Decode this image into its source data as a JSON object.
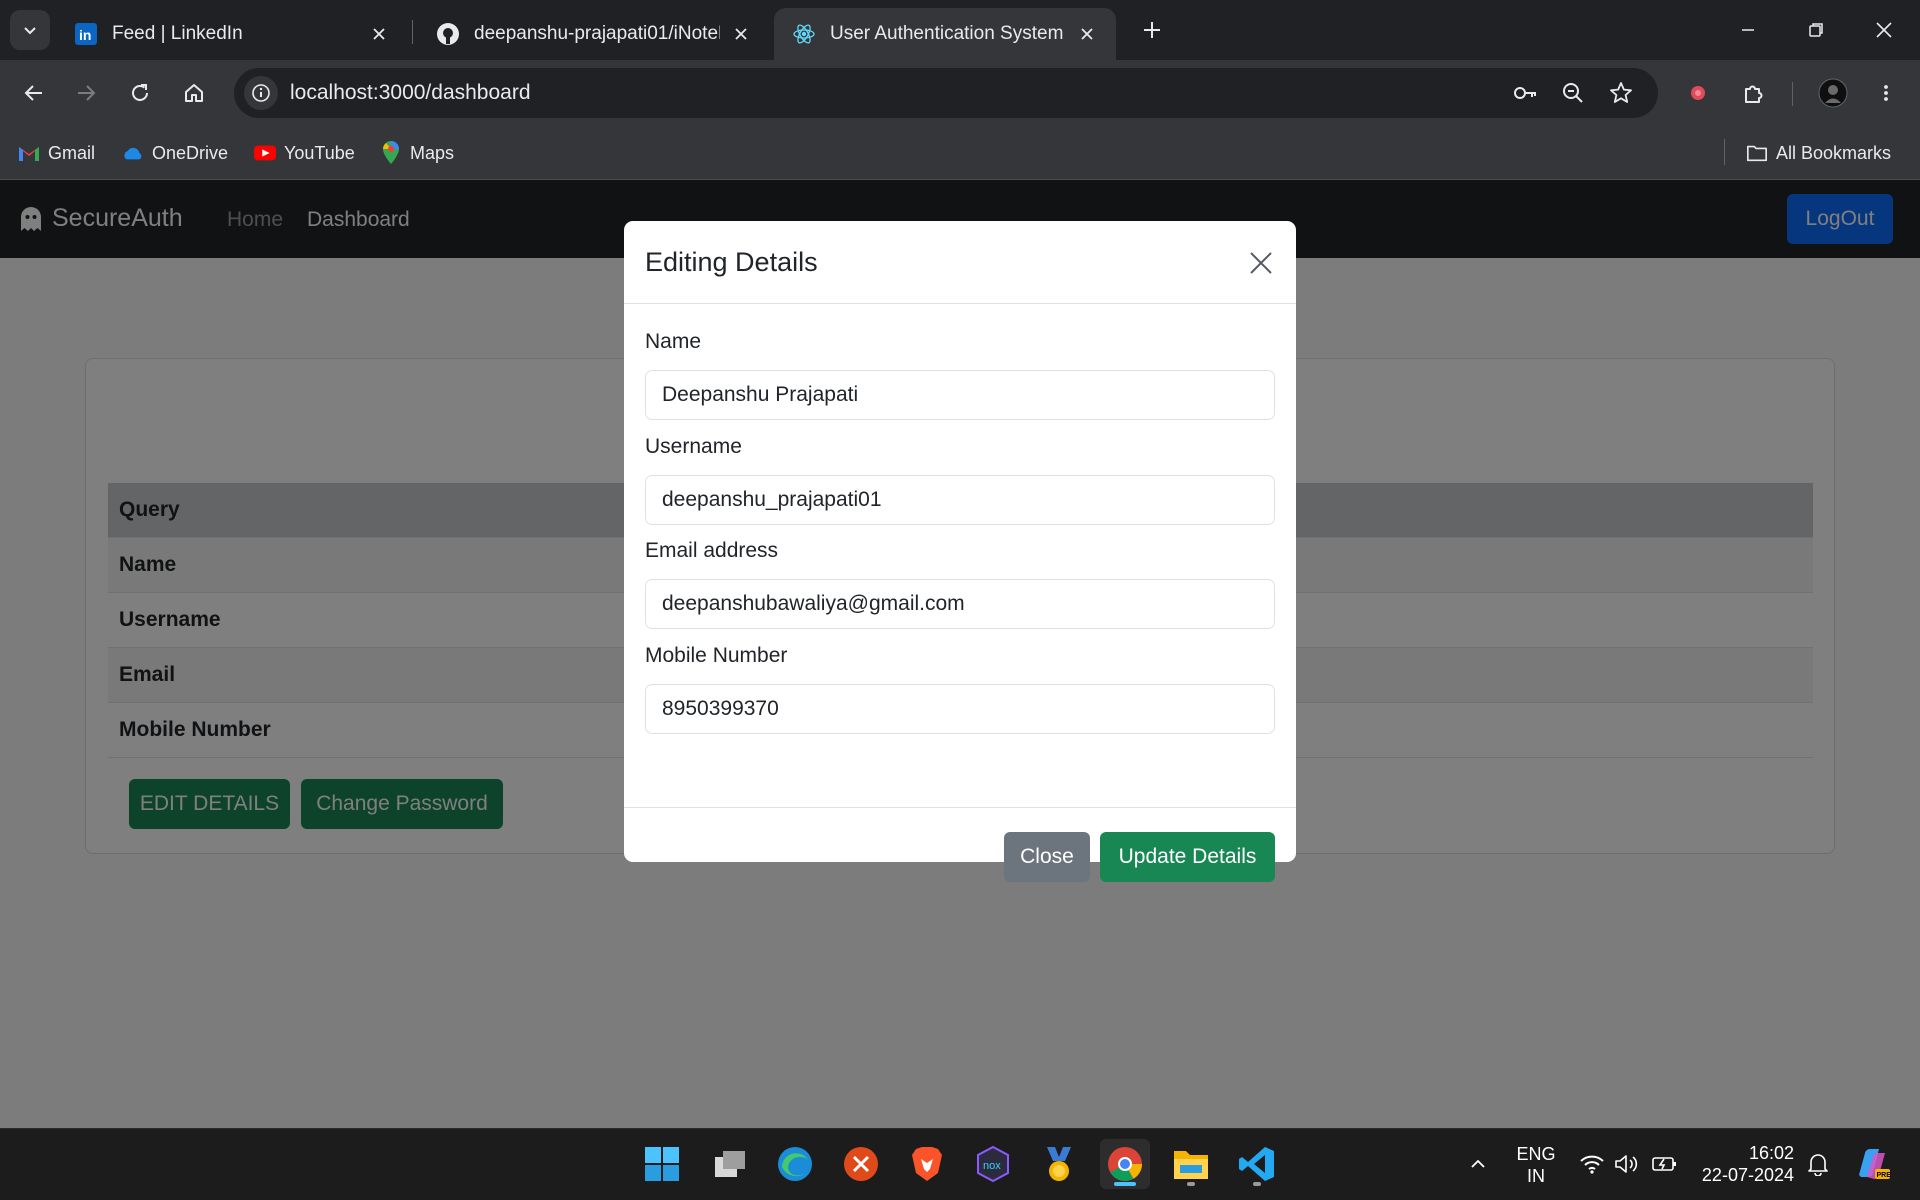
{
  "browser": {
    "tabs": [
      {
        "title": "Feed | LinkedIn",
        "icon": "linkedin-icon"
      },
      {
        "title": "deepanshu-prajapati01/iNoteBo",
        "icon": "github-icon"
      },
      {
        "title": "User Authentication System",
        "icon": "react-icon",
        "active": true
      }
    ],
    "url": "localhost:3000/dashboard",
    "bookmarks": [
      {
        "label": "Gmail",
        "icon": "gmail-icon"
      },
      {
        "label": "OneDrive",
        "icon": "onedrive-icon"
      },
      {
        "label": "YouTube",
        "icon": "youtube-icon"
      },
      {
        "label": "Maps",
        "icon": "maps-icon"
      }
    ],
    "all_bookmarks": "All Bookmarks"
  },
  "app": {
    "brand": "SecureAuth",
    "nav": {
      "home": "Home",
      "dashboard": "Dashboard"
    },
    "logout": "LogOut",
    "table": {
      "header": "Query",
      "rows": [
        "Name",
        "Username",
        "Email",
        "Mobile Number"
      ]
    },
    "buttons": {
      "edit": "EDIT DETAILS",
      "change_password": "Change Password"
    }
  },
  "modal": {
    "title": "Editing Details",
    "fields": {
      "name": {
        "label": "Name",
        "value": "Deepanshu Prajapati"
      },
      "username": {
        "label": "Username",
        "value": "deepanshu_prajapati01"
      },
      "email": {
        "label": "Email address",
        "value": "deepanshubawaliya@gmail.com"
      },
      "mobile": {
        "label": "Mobile Number",
        "value": "8950399370"
      }
    },
    "close": "Close",
    "update": "Update Details"
  },
  "taskbar": {
    "lang_top": "ENG",
    "lang_bottom": "IN",
    "time": "16:02",
    "date": "22-07-2024"
  },
  "colors": {
    "primary": "#0d6efd",
    "success": "#198754",
    "secondary": "#6c757d",
    "navbar": "#212529"
  }
}
